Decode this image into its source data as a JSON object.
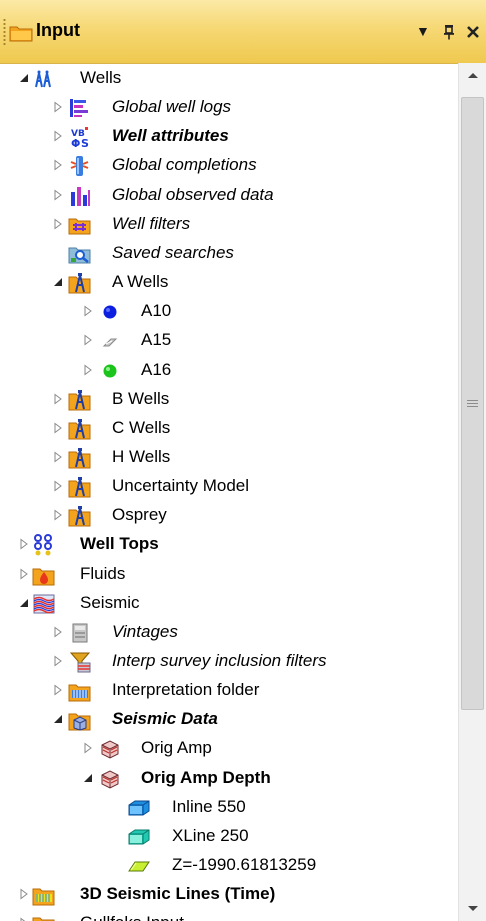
{
  "panel": {
    "title": "Input",
    "pin_glyph": "❑",
    "dropdown_glyph": "▾",
    "close_glyph": "✕"
  },
  "tree": [
    {
      "label": "Wells",
      "level": 0,
      "exp": "open",
      "icon": "wells-icon",
      "style": ""
    },
    {
      "label": "Global well logs",
      "level": 1,
      "exp": "closed",
      "icon": "global-well-logs-icon",
      "style": "it"
    },
    {
      "label": "Well attributes",
      "level": 1,
      "exp": "closed",
      "icon": "well-attributes-icon",
      "style": "it bd"
    },
    {
      "label": "Global completions",
      "level": 1,
      "exp": "closed",
      "icon": "global-completions-icon",
      "style": "it"
    },
    {
      "label": "Global observed data",
      "level": 1,
      "exp": "closed",
      "icon": "observed-data-icon",
      "style": "it"
    },
    {
      "label": "Well filters",
      "level": 1,
      "exp": "closed",
      "icon": "well-filters-icon",
      "style": "it"
    },
    {
      "label": "Saved searches",
      "level": 1,
      "exp": "none",
      "icon": "saved-searches-icon",
      "style": "it"
    },
    {
      "label": "A Wells",
      "level": 1,
      "exp": "open",
      "icon": "well-folder-icon",
      "style": ""
    },
    {
      "label": "A10",
      "level": 2,
      "exp": "closed",
      "icon": "blue-dot-icon",
      "style": ""
    },
    {
      "label": "A15",
      "level": 2,
      "exp": "closed",
      "icon": "grey-marker-icon",
      "style": ""
    },
    {
      "label": "A16",
      "level": 2,
      "exp": "closed",
      "icon": "green-dot-icon",
      "style": ""
    },
    {
      "label": "B Wells",
      "level": 1,
      "exp": "closed",
      "icon": "well-folder-icon",
      "style": ""
    },
    {
      "label": "C Wells",
      "level": 1,
      "exp": "closed",
      "icon": "well-folder-icon",
      "style": ""
    },
    {
      "label": "H Wells",
      "level": 1,
      "exp": "closed",
      "icon": "well-folder-icon",
      "style": ""
    },
    {
      "label": "Uncertainty Model",
      "level": 1,
      "exp": "closed",
      "icon": "well-folder-icon",
      "style": ""
    },
    {
      "label": "Osprey",
      "level": 1,
      "exp": "closed",
      "icon": "well-folder-icon",
      "style": ""
    },
    {
      "label": "Well Tops",
      "level": 0,
      "exp": "closed",
      "icon": "well-tops-icon",
      "style": "bd"
    },
    {
      "label": "Fluids",
      "level": 0,
      "exp": "closed",
      "icon": "fluids-icon",
      "style": ""
    },
    {
      "label": "Seismic",
      "level": 0,
      "exp": "open",
      "icon": "seismic-icon",
      "style": ""
    },
    {
      "label": "Vintages",
      "level": 1,
      "exp": "closed",
      "icon": "vintages-icon",
      "style": "it"
    },
    {
      "label": "Interp survey inclusion filters",
      "level": 1,
      "exp": "closed",
      "icon": "filter-funnel-icon",
      "style": "it"
    },
    {
      "label": "Interpretation folder",
      "level": 1,
      "exp": "closed",
      "icon": "interpretation-folder-icon",
      "style": ""
    },
    {
      "label": "Seismic Data",
      "level": 1,
      "exp": "open",
      "icon": "seismic-data-icon",
      "style": "it bd"
    },
    {
      "label": "Orig Amp",
      "level": 2,
      "exp": "closed",
      "icon": "seismic-cube-icon",
      "style": ""
    },
    {
      "label": "Orig Amp Depth",
      "level": 2,
      "exp": "open",
      "icon": "seismic-cube-icon",
      "style": "bd"
    },
    {
      "label": "Inline 550",
      "level": 3,
      "exp": "none",
      "icon": "inline-slice-icon",
      "style": ""
    },
    {
      "label": "XLine 250",
      "level": 3,
      "exp": "none",
      "icon": "xline-slice-icon",
      "style": ""
    },
    {
      "label": "Z=-1990.61813259",
      "level": 3,
      "exp": "none",
      "icon": "z-slice-icon",
      "style": ""
    },
    {
      "label": "3D Seismic Lines (Time)",
      "level": 0,
      "exp": "closed",
      "icon": "seismic-lines-folder-icon",
      "style": "bd"
    },
    {
      "label": "Gullfaks Input",
      "level": 0,
      "exp": "closed",
      "icon": "folder-icon",
      "style": ""
    }
  ]
}
